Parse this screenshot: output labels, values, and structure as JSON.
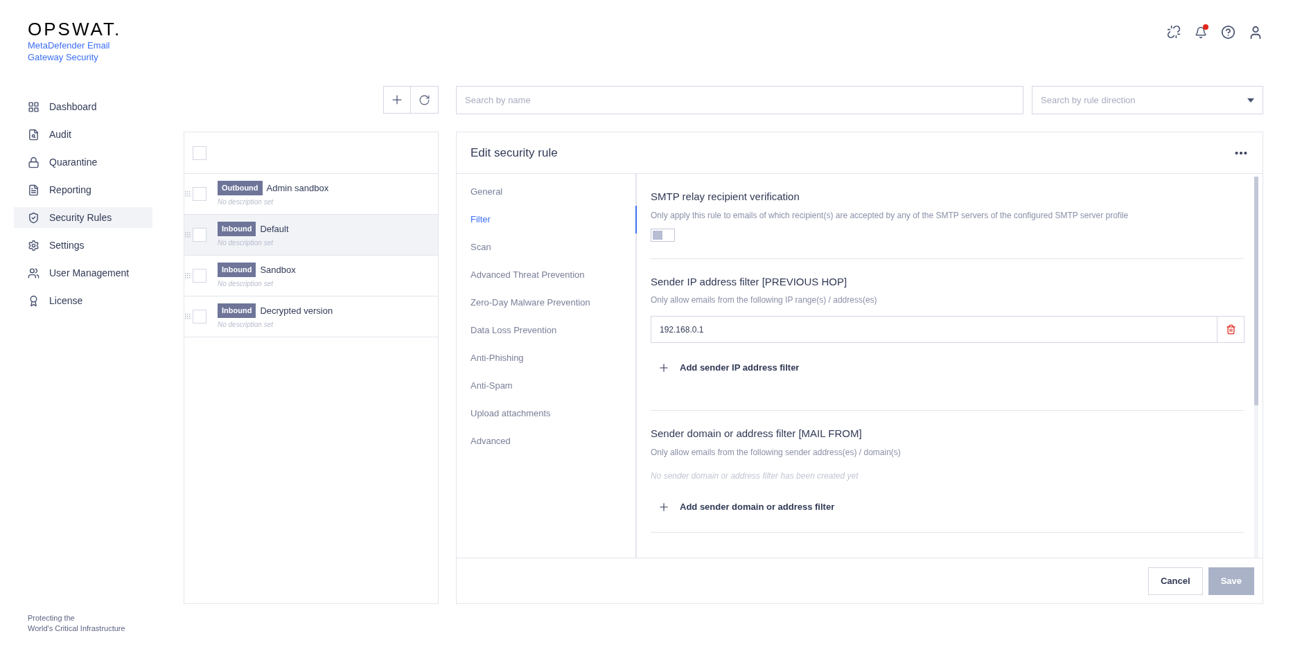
{
  "logo": {
    "brand": "OPSWAT.",
    "product": [
      "MetaDefender Email",
      "Gateway Security"
    ]
  },
  "header": {
    "notification_dot": true
  },
  "sidebar": {
    "items": [
      {
        "label": "Dashboard",
        "selected": false
      },
      {
        "label": "Audit",
        "selected": false
      },
      {
        "label": "Quarantine",
        "selected": false
      },
      {
        "label": "Reporting",
        "selected": false
      },
      {
        "label": "Security Rules",
        "selected": true
      },
      {
        "label": "Settings",
        "selected": false
      },
      {
        "label": "User Management",
        "selected": false
      },
      {
        "label": "License",
        "selected": false
      }
    ],
    "footer": [
      "Protecting the",
      "World's Critical Infrastructure"
    ]
  },
  "search": {
    "placeholder": "Search by name"
  },
  "direction_filter": {
    "placeholder": "Search by rule direction"
  },
  "rules": {
    "select_all": {
      "checked": false
    },
    "rows": [
      {
        "direction": "Outbound",
        "name": "Admin sandbox",
        "description": "No description set",
        "selected": false,
        "checked": false
      },
      {
        "direction": "Inbound",
        "name": "Default",
        "description": "No description set",
        "selected": true,
        "checked": false
      },
      {
        "direction": "Inbound",
        "name": "Sandbox",
        "description": "No description set",
        "selected": false,
        "checked": false
      },
      {
        "direction": "Inbound",
        "name": "Decrypted version",
        "description": "No description set",
        "selected": false,
        "checked": false
      }
    ]
  },
  "editor": {
    "title": "Edit security rule",
    "tabs": [
      {
        "label": "General",
        "selected": false
      },
      {
        "label": "Filter",
        "selected": true
      },
      {
        "label": "Scan",
        "selected": false
      },
      {
        "label": "Advanced Threat Prevention",
        "selected": false
      },
      {
        "label": "Zero-Day Malware Prevention",
        "selected": false
      },
      {
        "label": "Data Loss Prevention",
        "selected": false
      },
      {
        "label": "Anti-Phishing",
        "selected": false
      },
      {
        "label": "Anti-Spam",
        "selected": false
      },
      {
        "label": "Upload attachments",
        "selected": false
      },
      {
        "label": "Advanced",
        "selected": false
      }
    ],
    "sections": [
      {
        "kind": "toggle",
        "title": "SMTP relay recipient verification",
        "description": "Only apply this rule to emails of which recipient(s) are accepted by any of the SMTP servers of the configured SMTP server profile",
        "on": false
      },
      {
        "kind": "list",
        "title": "Sender IP address filter [PREVIOUS HOP]",
        "description": "Only allow emails from the following IP range(s) / address(es)",
        "entries": [
          "192.168.0.1"
        ],
        "add_label": "Add sender IP address filter"
      },
      {
        "kind": "list",
        "title": "Sender domain or address filter [MAIL FROM]",
        "description": "Only allow emails from the following sender address(es) / domain(s)",
        "empty_text": "No sender domain or address filter has been created yet",
        "add_label": "Add sender domain or address filter"
      }
    ],
    "buttons": [
      {
        "label": "Cancel",
        "disabled": false
      },
      {
        "label": "Save",
        "disabled": true
      }
    ]
  }
}
